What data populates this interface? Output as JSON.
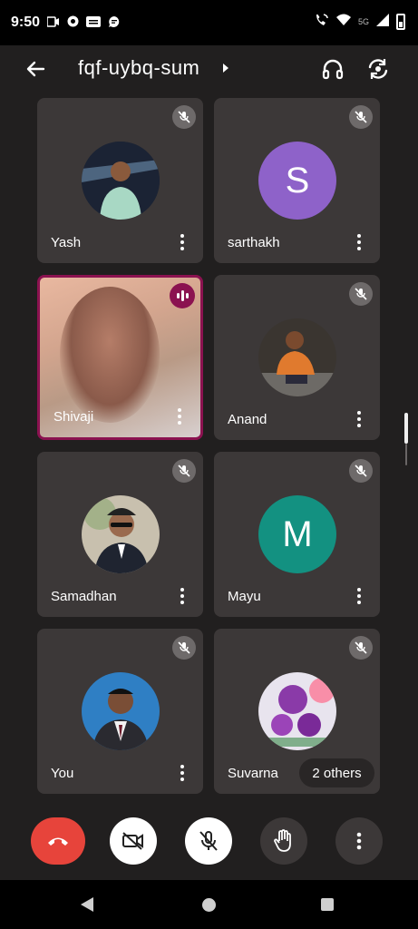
{
  "status_bar": {
    "time": "9:50",
    "network_label": "5G",
    "icons": [
      "video-record-icon",
      "app-icon",
      "news-app-icon",
      "chat-icon",
      "call-wifi-icon",
      "wifi-icon",
      "signal-icon",
      "battery-icon"
    ]
  },
  "header": {
    "meeting_code": "fqf-uybq-sum",
    "icons": [
      "back-arrow-icon",
      "caret-right-icon",
      "headphones-icon",
      "flip-camera-icon"
    ]
  },
  "participants": [
    {
      "name": "Yash",
      "type": "photo",
      "muted": true
    },
    {
      "name": "sarthakh",
      "type": "initial",
      "initial": "S",
      "color": "#8e62c9",
      "muted": true
    },
    {
      "name": "Shivaji",
      "type": "video",
      "speaking": true
    },
    {
      "name": "Anand",
      "type": "photo",
      "muted": true
    },
    {
      "name": "Samadhan",
      "type": "photo",
      "muted": true
    },
    {
      "name": "Mayu",
      "type": "initial",
      "initial": "M",
      "color": "#139181",
      "muted": true
    },
    {
      "name": "You",
      "type": "photo",
      "muted": true
    },
    {
      "name": "Suvarna",
      "type": "photo",
      "muted": true
    }
  ],
  "others_chip": "2 others",
  "controls": {
    "icons": [
      "end-call-icon",
      "camera-off-icon",
      "mic-off-icon",
      "raise-hand-icon",
      "more-options-icon"
    ],
    "colors": {
      "end_call": "#e7443b",
      "active_bg": "#ffffff",
      "inactive_bg": "#3c3838",
      "speaking_border": "#8b1250"
    }
  }
}
